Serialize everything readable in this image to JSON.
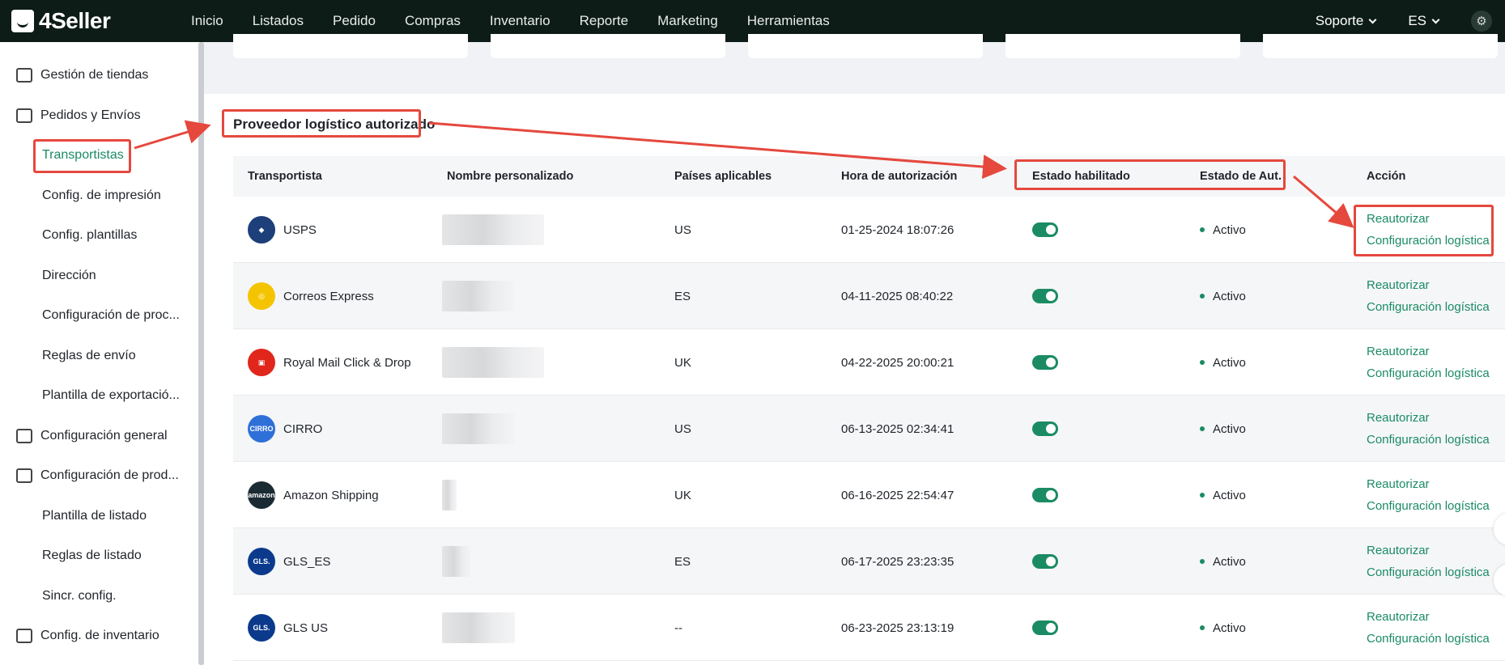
{
  "app": {
    "brand": "4Seller"
  },
  "nav": {
    "items": [
      "Inicio",
      "Listados",
      "Pedido",
      "Compras",
      "Inventario",
      "Reporte",
      "Marketing",
      "Herramientas"
    ]
  },
  "topbar": {
    "support": "Soporte",
    "language": "ES"
  },
  "sidebar": {
    "items": [
      {
        "label": "Gestión de tiendas",
        "level": "top",
        "icon": "store-icon"
      },
      {
        "label": "Pedidos y Envíos",
        "level": "top",
        "icon": "order-icon"
      },
      {
        "label": "Transportistas",
        "level": "sub",
        "active": true
      },
      {
        "label": "Config. de impresión",
        "level": "sub"
      },
      {
        "label": "Config. plantillas",
        "level": "sub"
      },
      {
        "label": "Dirección",
        "level": "sub"
      },
      {
        "label": "Configuración de proc...",
        "level": "sub"
      },
      {
        "label": "Reglas de envío",
        "level": "sub"
      },
      {
        "label": "Plantilla de exportació...",
        "level": "sub"
      },
      {
        "label": "Configuración general",
        "level": "top",
        "icon": "printer-icon"
      },
      {
        "label": "Configuración de prod...",
        "level": "top",
        "icon": "product-icon"
      },
      {
        "label": "Plantilla de listado",
        "level": "sub"
      },
      {
        "label": "Reglas de listado",
        "level": "sub"
      },
      {
        "label": "Sincr. config.",
        "level": "sub"
      },
      {
        "label": "Config. de inventario",
        "level": "top",
        "icon": "inventory-icon"
      }
    ]
  },
  "panel": {
    "title": "Proveedor logístico autorizado",
    "columns": {
      "carrier": "Transportista",
      "custom_name": "Nombre personalizado",
      "countries": "Países aplicables",
      "auth_time": "Hora de autorización",
      "enabled": "Estado habilitado",
      "auth_status": "Estado de Aut.",
      "action": "Acción"
    },
    "rows": [
      {
        "carrier": "USPS",
        "logo": "usps-logo",
        "logo_color": "#1d3f7a",
        "countries": "US",
        "auth_time": "01-25-2024 18:07:26",
        "enabled": true,
        "status": "Activo",
        "reauth": "Reautorizar",
        "config": "Configuración logística"
      },
      {
        "carrier": "Correos Express",
        "logo": "correos-express-logo",
        "logo_color": "#f5c400",
        "countries": "ES",
        "auth_time": "04-11-2025 08:40:22",
        "enabled": true,
        "status": "Activo",
        "reauth": "Reautorizar",
        "config": "Configuración logística"
      },
      {
        "carrier": "Royal Mail Click & Drop",
        "logo": "royal-mail-logo",
        "logo_color": "#e1261c",
        "countries": "UK",
        "auth_time": "04-22-2025 20:00:21",
        "enabled": true,
        "status": "Activo",
        "reauth": "Reautorizar",
        "config": "Configuración logística"
      },
      {
        "carrier": "CIRRO",
        "logo": "cirro-logo",
        "logo_color": "#2f6fd8",
        "countries": "US",
        "auth_time": "06-13-2025 02:34:41",
        "enabled": true,
        "status": "Activo",
        "reauth": "Reautorizar",
        "config": "Configuración logística"
      },
      {
        "carrier": "Amazon Shipping",
        "logo": "amazon-shipping-logo",
        "logo_color": "#1b2b33",
        "countries": "UK",
        "auth_time": "06-16-2025 22:54:47",
        "enabled": true,
        "status": "Activo",
        "reauth": "Reautorizar",
        "config": "Configuración logística"
      },
      {
        "carrier": "GLS_ES",
        "logo": "gls-logo",
        "logo_color": "#0b3a8c",
        "countries": "ES",
        "auth_time": "06-17-2025 23:23:35",
        "enabled": true,
        "status": "Activo",
        "reauth": "Reautorizar",
        "config": "Configuración logística"
      },
      {
        "carrier": "GLS US",
        "logo": "gls-logo",
        "logo_color": "#0b3a8c",
        "countries": "--",
        "auth_time": "06-23-2025 23:13:19",
        "enabled": true,
        "status": "Activo",
        "reauth": "Reautorizar",
        "config": "Configuración logística"
      }
    ]
  },
  "colors": {
    "accent": "#1a8b63",
    "topbar": "#0d1c17",
    "annotation": "#e5483d"
  }
}
